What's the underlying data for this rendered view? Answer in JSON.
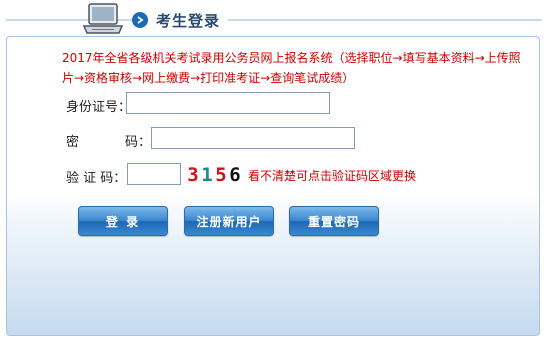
{
  "header": {
    "title": "考生登录",
    "icon": "laptop-icon"
  },
  "notice": "2017年全省各级机关考试录用公务员网上报名系统（选择职位→填写基本资料→上传照片→资格审核→网上缴费→打印准考证→查询笔试成绩）",
  "form": {
    "id_label": "身份证号：",
    "id_value": "",
    "password_label_char1": "密",
    "password_label_char2": "码：",
    "password_value": "",
    "captcha_label": "验 证 码：",
    "captcha_value": "",
    "captcha_chars": [
      "3",
      "1",
      "5",
      "6"
    ],
    "captcha_colors": [
      "#d2141a",
      "#1b8a8a",
      "#c7141a",
      "#111111"
    ],
    "captcha_hint": "看不清楚可点击验证码区域更换"
  },
  "buttons": {
    "login": "登 录",
    "register": "注册新用户",
    "reset_password": "重置密码"
  },
  "colors": {
    "accent_blue": "#1f67b3",
    "notice_red": "#cc0000"
  }
}
